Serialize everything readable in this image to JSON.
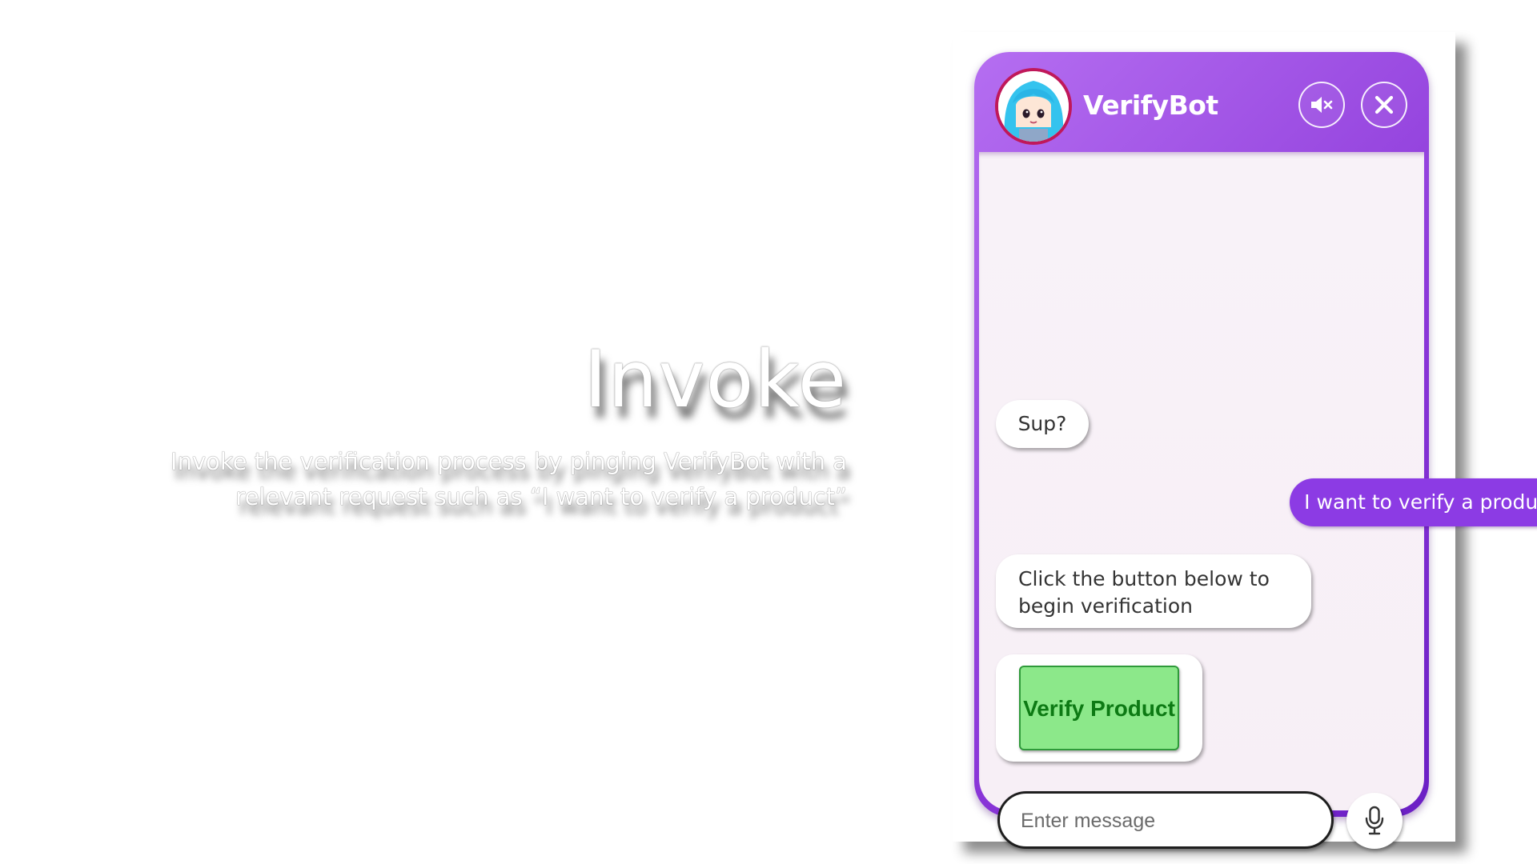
{
  "caption": {
    "title": "Invoke",
    "body": "Invoke the verification process by pinging VerifyBot with a relevant request such as “I want to verify a product”"
  },
  "chat": {
    "bot_name": "VerifyBot",
    "avatar_icon": "anime-avatar",
    "mute_icon": "speaker-muted-icon",
    "close_icon": "close-icon",
    "messages": [
      {
        "from": "bot",
        "text": "Sup?"
      },
      {
        "from": "user",
        "text": "I want to verify a product"
      },
      {
        "from": "bot",
        "text": "Click the button below to begin verification"
      }
    ],
    "verify_button_label": "Verify Product",
    "input_placeholder": "Enter message",
    "mic_icon": "microphone-icon"
  },
  "colors": {
    "header_gradient_start": "#b56ef1",
    "header_gradient_end": "#6a1fc4",
    "user_bubble": "#8c3be4",
    "verify_button_bg": "#8ce88a",
    "verify_button_text": "#0d7a14",
    "chat_background": "#f8f2f8"
  }
}
